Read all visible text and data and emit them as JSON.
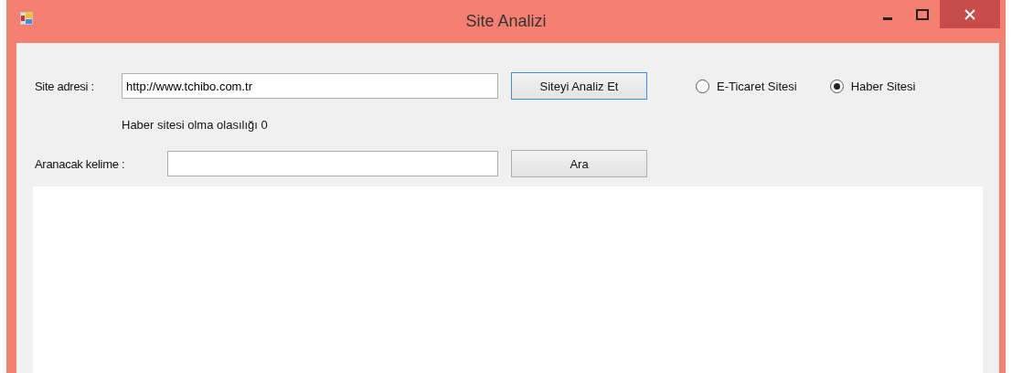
{
  "window": {
    "title": "Site Analizi"
  },
  "site_address": {
    "label": "Site adresi :",
    "value": "http://www.tchibo.com.tr"
  },
  "analyze_button": {
    "label": "Siteyi Analiz Et",
    "focused": true
  },
  "site_types": [
    {
      "label": "E-Ticaret Sitesi",
      "selected": false
    },
    {
      "label": "Haber Sitesi",
      "selected": true
    }
  ],
  "result": "Haber sitesi olma olasılığı 0",
  "search": {
    "label": "Aranacak kelime :"
  },
  "search_button": {
    "label": "Ara",
    "focused": false
  }
}
